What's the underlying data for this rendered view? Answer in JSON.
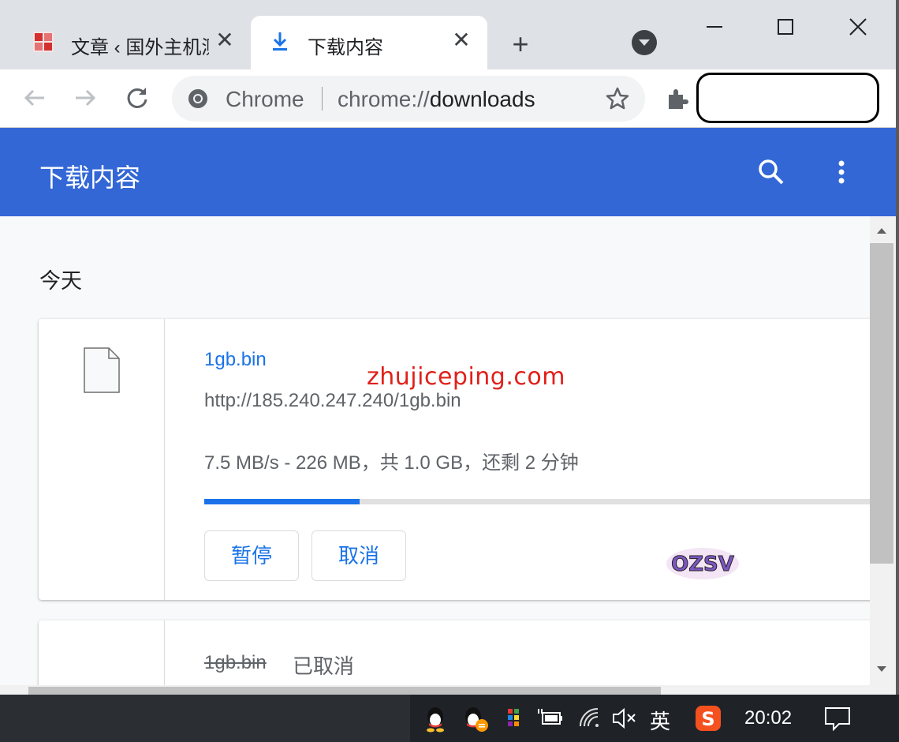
{
  "tabs": [
    {
      "title": "文章 ‹ 国外主机测",
      "icon": "site-favicon",
      "active": false,
      "close": "✕"
    },
    {
      "title": "下载内容",
      "icon": "download-icon",
      "active": true,
      "close": "✕"
    }
  ],
  "tabstrip": {
    "new_tab": "+"
  },
  "toolbar": {
    "omnibox_label": "Chrome",
    "url_prefix": "chrome://",
    "url_host": "downloads"
  },
  "downloads": {
    "title": "下载内容",
    "date_group": "今天",
    "items": [
      {
        "filename": "1gb.bin",
        "url": "http://185.240.247.240/1gb.bin",
        "status": "7.5 MB/s - 226 MB，共 1.0 GB，还剩 2 分钟",
        "progress": 0.226,
        "pause_label": "暂停",
        "cancel_label": "取消"
      },
      {
        "filename": "1gb.bin",
        "state": "已取消"
      }
    ]
  },
  "watermark": "zhujiceping.com",
  "logo_text": "OZSV",
  "taskbar": {
    "ime_label": "英",
    "time": "20:02"
  },
  "colors": {
    "accent": "#1a73e8",
    "header": "#3367d6",
    "watermark": "#e0201a"
  }
}
